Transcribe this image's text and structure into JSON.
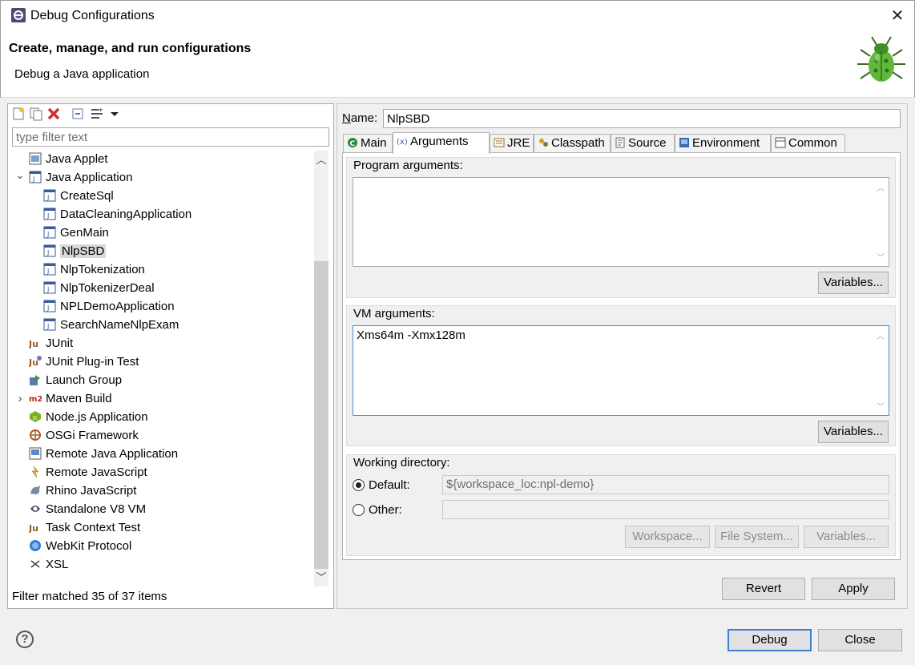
{
  "window": {
    "title": "Debug Configurations",
    "close_glyph": "✕"
  },
  "banner": {
    "title": "Create, manage, and run configurations",
    "subtitle": "Debug a Java application"
  },
  "left": {
    "filter_placeholder": "type filter text",
    "tree": [
      {
        "label": "Java Applet",
        "icon": "java-applet-icon",
        "level": 0
      },
      {
        "label": "Java Application",
        "icon": "java-application-icon",
        "level": 0,
        "expanded": true
      },
      {
        "label": "CreateSql",
        "icon": "java-class-icon",
        "level": 1
      },
      {
        "label": "DataCleaningApplication",
        "icon": "java-class-icon",
        "level": 1
      },
      {
        "label": "GenMain",
        "icon": "java-class-icon",
        "level": 1
      },
      {
        "label": "NlpSBD",
        "icon": "java-class-icon",
        "level": 1,
        "selected": true
      },
      {
        "label": "NlpTokenization",
        "icon": "java-class-icon",
        "level": 1
      },
      {
        "label": "NlpTokenizerDeal",
        "icon": "java-class-icon",
        "level": 1
      },
      {
        "label": "NPLDemoApplication",
        "icon": "java-class-icon",
        "level": 1
      },
      {
        "label": "SearchNameNlpExam",
        "icon": "java-class-icon",
        "level": 1
      },
      {
        "label": "JUnit",
        "icon": "junit-icon",
        "level": 0
      },
      {
        "label": "JUnit Plug-in Test",
        "icon": "junit-plugin-icon",
        "level": 0
      },
      {
        "label": "Launch Group",
        "icon": "launch-group-icon",
        "level": 0
      },
      {
        "label": "Maven Build",
        "icon": "maven-icon",
        "level": 0,
        "collapsed": true
      },
      {
        "label": "Node.js Application",
        "icon": "nodejs-icon",
        "level": 0
      },
      {
        "label": "OSGi Framework",
        "icon": "osgi-icon",
        "level": 0
      },
      {
        "label": "Remote Java Application",
        "icon": "remote-java-icon",
        "level": 0
      },
      {
        "label": "Remote JavaScript",
        "icon": "remote-javascript-icon",
        "level": 0
      },
      {
        "label": "Rhino JavaScript",
        "icon": "rhino-icon",
        "level": 0
      },
      {
        "label": "Standalone V8 VM",
        "icon": "v8-icon",
        "level": 0
      },
      {
        "label": "Task Context Test",
        "icon": "task-context-icon",
        "level": 0
      },
      {
        "label": "WebKit Protocol",
        "icon": "webkit-icon",
        "level": 0
      },
      {
        "label": "XSL",
        "icon": "xsl-icon",
        "level": 0
      }
    ],
    "status": "Filter matched 35 of 37 items"
  },
  "right": {
    "name_label": "Name:",
    "name_value": "NlpSBD",
    "tabs": [
      {
        "label": "Main",
        "icon": "main-tab-icon"
      },
      {
        "label": "Arguments",
        "icon": "arguments-tab-icon",
        "active": true
      },
      {
        "label": "JRE",
        "icon": "jre-tab-icon"
      },
      {
        "label": "Classpath",
        "icon": "classpath-tab-icon"
      },
      {
        "label": "Source",
        "icon": "source-tab-icon"
      },
      {
        "label": "Environment",
        "icon": "environment-tab-icon"
      },
      {
        "label": "Common",
        "icon": "common-tab-icon"
      }
    ],
    "program_args_label": "Program arguments:",
    "program_args_value": "",
    "vm_args_label": "VM arguments:",
    "vm_args_value": "Xms64m -Xmx128m",
    "variables_label": "Variables...",
    "working_dir_label": "Working directory:",
    "default_label": "Default:",
    "default_value": "${workspace_loc:npl-demo}",
    "other_label": "Other:",
    "other_value": "",
    "workspace_btn": "Workspace...",
    "filesystem_btn": "File System...",
    "variables_btn": "Variables...",
    "revert_btn": "Revert",
    "apply_btn": "Apply"
  },
  "footer": {
    "debug_btn": "Debug",
    "close_btn": "Close",
    "help_glyph": "?"
  },
  "colors": {
    "accent": "#3c7fd4",
    "selection": "#d9d9d9"
  }
}
